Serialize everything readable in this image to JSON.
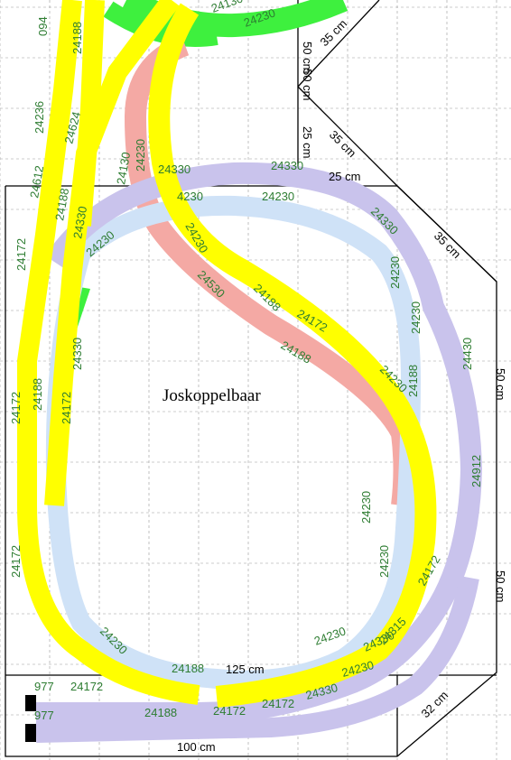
{
  "title": "Joskoppelbaar",
  "colors": {
    "track_yellow": "#ffff00",
    "track_lightblue": "#cfe2f7",
    "track_lavender": "#c9c3ec",
    "track_pink": "#f4a9a4",
    "track_green": "#3ef03e",
    "label_green": "#2e7d32",
    "grid": "#9a9a9a"
  },
  "dimensions": [
    "35 cm",
    "50 cm",
    "25 cm",
    "35 cm",
    "25 cm",
    "35 cm",
    "50 cm",
    "50 cm",
    "125 cm",
    "100 cm",
    "32 cm",
    "50 cm"
  ],
  "piece_labels": [
    "24130",
    "24230",
    "094",
    "24188",
    "24236",
    "24624",
    "24612",
    "24188",
    "24130",
    "24230",
    "24330",
    "4230",
    "24230",
    "24330",
    "24330",
    "24230",
    "24172",
    "24330",
    "24230",
    "24188",
    "24530",
    "24172",
    "24188",
    "24230",
    "24188",
    "24430",
    "24912",
    "24230",
    "24230",
    "24172",
    "24315",
    "24330",
    "24230",
    "24230",
    "24230",
    "24172",
    "24188",
    "24172",
    "24330",
    "977",
    "977",
    "24172",
    "24188",
    "24172",
    "24172",
    "24188",
    "24230",
    "24330",
    "24230",
    "24172"
  ]
}
